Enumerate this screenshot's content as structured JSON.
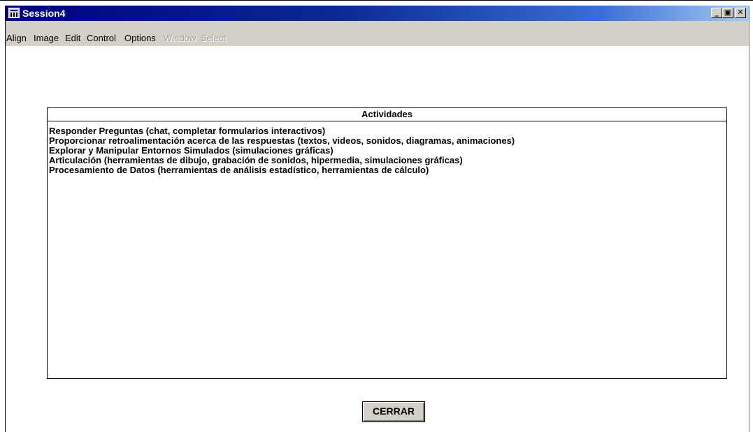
{
  "window": {
    "title": "Session4",
    "controls": {
      "minimize": "_",
      "maximize": "▣",
      "close": "✕"
    }
  },
  "menubar": {
    "items": [
      {
        "label": "Align",
        "enabled": true
      },
      {
        "label": "Image",
        "enabled": true
      },
      {
        "label": "Edit",
        "enabled": true
      },
      {
        "label": "Control",
        "enabled": true
      },
      {
        "label": "Options",
        "enabled": true
      },
      {
        "label": "Window",
        "enabled": false
      },
      {
        "label": "Select",
        "enabled": false
      }
    ]
  },
  "panel": {
    "header": "Actividades",
    "items": [
      "Responder Preguntas (chat, completar formularios interactivos)",
      "Proporcionar retroalimentación acerca de las respuestas (textos, videos, sonidos, diagramas, animaciones)",
      "Explorar y Manipular Entornos Simulados (simulaciones gráficas)",
      "Articulación (herramientas de dibujo, grabación de sonidos, hipermedia, simulaciones gráficas)",
      "Procesamiento de Datos (herramientas de análisis estadístico, herramientas de cálculo)"
    ]
  },
  "buttons": {
    "close_label": "CERRAR"
  },
  "colors": {
    "titlebar_start": "#000080",
    "titlebar_end": "#a6caf0",
    "menubar_bg": "#d4d0c8"
  },
  "icons": {
    "app": "app-window-icon"
  }
}
